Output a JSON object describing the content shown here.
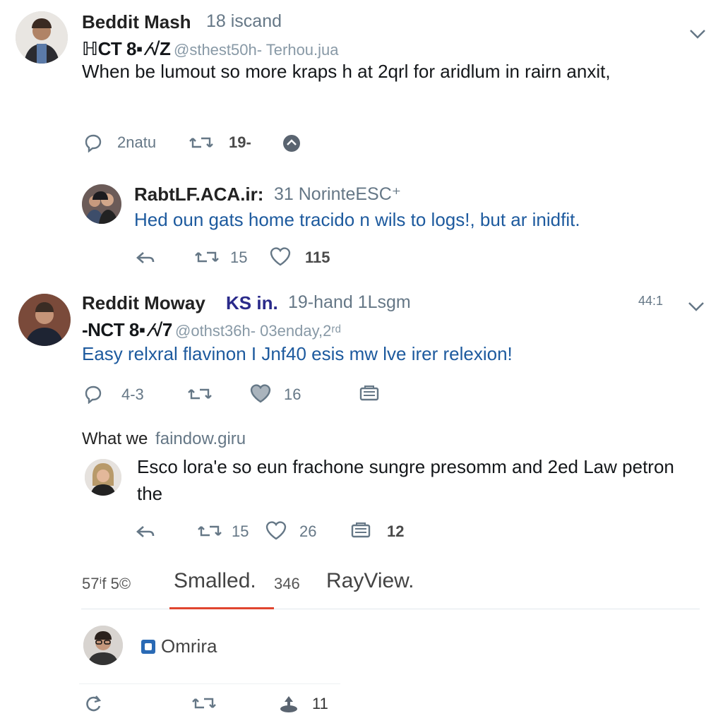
{
  "posts": [
    {
      "name": "Beddit Mash",
      "meta": "18 iscand",
      "handle_strong": "ℍCT 8▪ ⁄√Z",
      "handle": "@sthest50h- Terhou.jua",
      "body": "When be lumout so more kraps h at 2qrl  for aridlum in rairn anxit,",
      "actions": {
        "replies": "2natu",
        "retweets": "19-"
      }
    },
    {
      "name": "RabtLF.ACA.ir:",
      "meta": "31 NorinteESC⁺",
      "body": "Hed oun gats home tracido n wils to logs!, but ar inidfit.",
      "actions": {
        "retweets": "15",
        "likes": "115"
      }
    },
    {
      "name": "Reddit Moway",
      "name_accent": "KS in.",
      "meta": "19-hand 1Lsgm",
      "corner": "44:1",
      "handle_strong": "-NCT 8▪ ⁄√7",
      "handle": "@othst36h- 03enday,2ʳᵈ",
      "body": "Easy relxral flavinon I Jnf40 esis mw lve irer relexion!",
      "actions": {
        "replies": "4-3",
        "likes": "16"
      }
    },
    {
      "context": "What we",
      "context_link": "faindow.giru",
      "body": "Esco lora'e so eun frachone sungre presomm and 2ed Law petron the",
      "actions": {
        "retweets": "15",
        "likes": "26",
        "other": "12"
      }
    }
  ],
  "tabs": {
    "left_small": "57ⁱf 5©",
    "active": "Smalled.",
    "count": "346",
    "other": "RayView."
  },
  "composer": {
    "label": "Omrira",
    "likes": "11"
  },
  "colors": {
    "accent": "#e0452f",
    "link": "#1d5a9e",
    "muted": "#657786",
    "flag": "#2a6ab5"
  }
}
